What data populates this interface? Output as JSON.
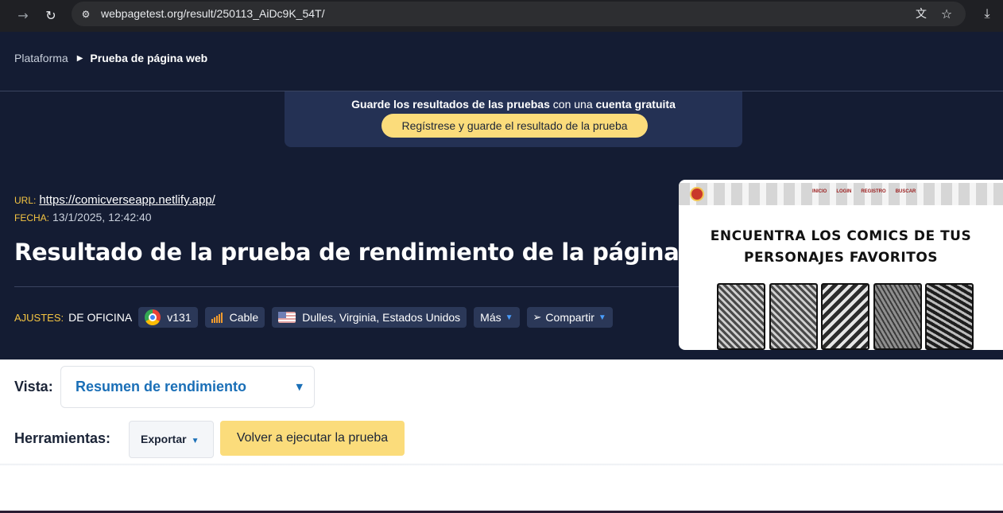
{
  "browser": {
    "url": "webpagetest.org/result/250113_AiDc9K_54T/",
    "icons": [
      "forward-icon",
      "reload-icon",
      "site-info-icon",
      "translate-icon",
      "star-icon",
      "download-icon"
    ]
  },
  "breadcrumb": {
    "root": "Plataforma",
    "current": "Prueba de página web"
  },
  "banner": {
    "text_bold_1": "Guarde los resultados de las pruebas",
    "text_mid": " con una ",
    "text_bold_2": "cuenta gratuita",
    "button": "Regístrese y guarde el resultado de la prueba"
  },
  "test": {
    "url_label": "URL:",
    "url": "https://comicverseapp.netlify.app/",
    "date_label": "FECHA:",
    "date": "13/1/2025, 12:42:40",
    "title": "Resultado de la prueba de rendimiento de la página web"
  },
  "settings": {
    "label": "AJUSTES:",
    "value": "DE OFICINA",
    "browser_version": "v131",
    "connection": "Cable",
    "location": "Dulles, Virginia, Estados Unidos",
    "more": "Más",
    "share": "Compartir"
  },
  "preview": {
    "nav_links": [
      "INICIO",
      "LOGIN",
      "REGISTRO",
      "BUSCAR"
    ],
    "heading_line1": "ENCUENTRA LOS COMICS DE TUS",
    "heading_line2": "PERSONAJES FAVORITOS"
  },
  "view": {
    "label": "Vista:",
    "selected": "Resumen de rendimiento"
  },
  "tools": {
    "label": "Herramientas:",
    "export": "Exportar",
    "rerun": "Volver a ejecutar la prueba"
  },
  "colors": {
    "header_bg": "#141c33",
    "accent_yellow": "#fbdc7b",
    "link_blue": "#1a6fb7"
  }
}
